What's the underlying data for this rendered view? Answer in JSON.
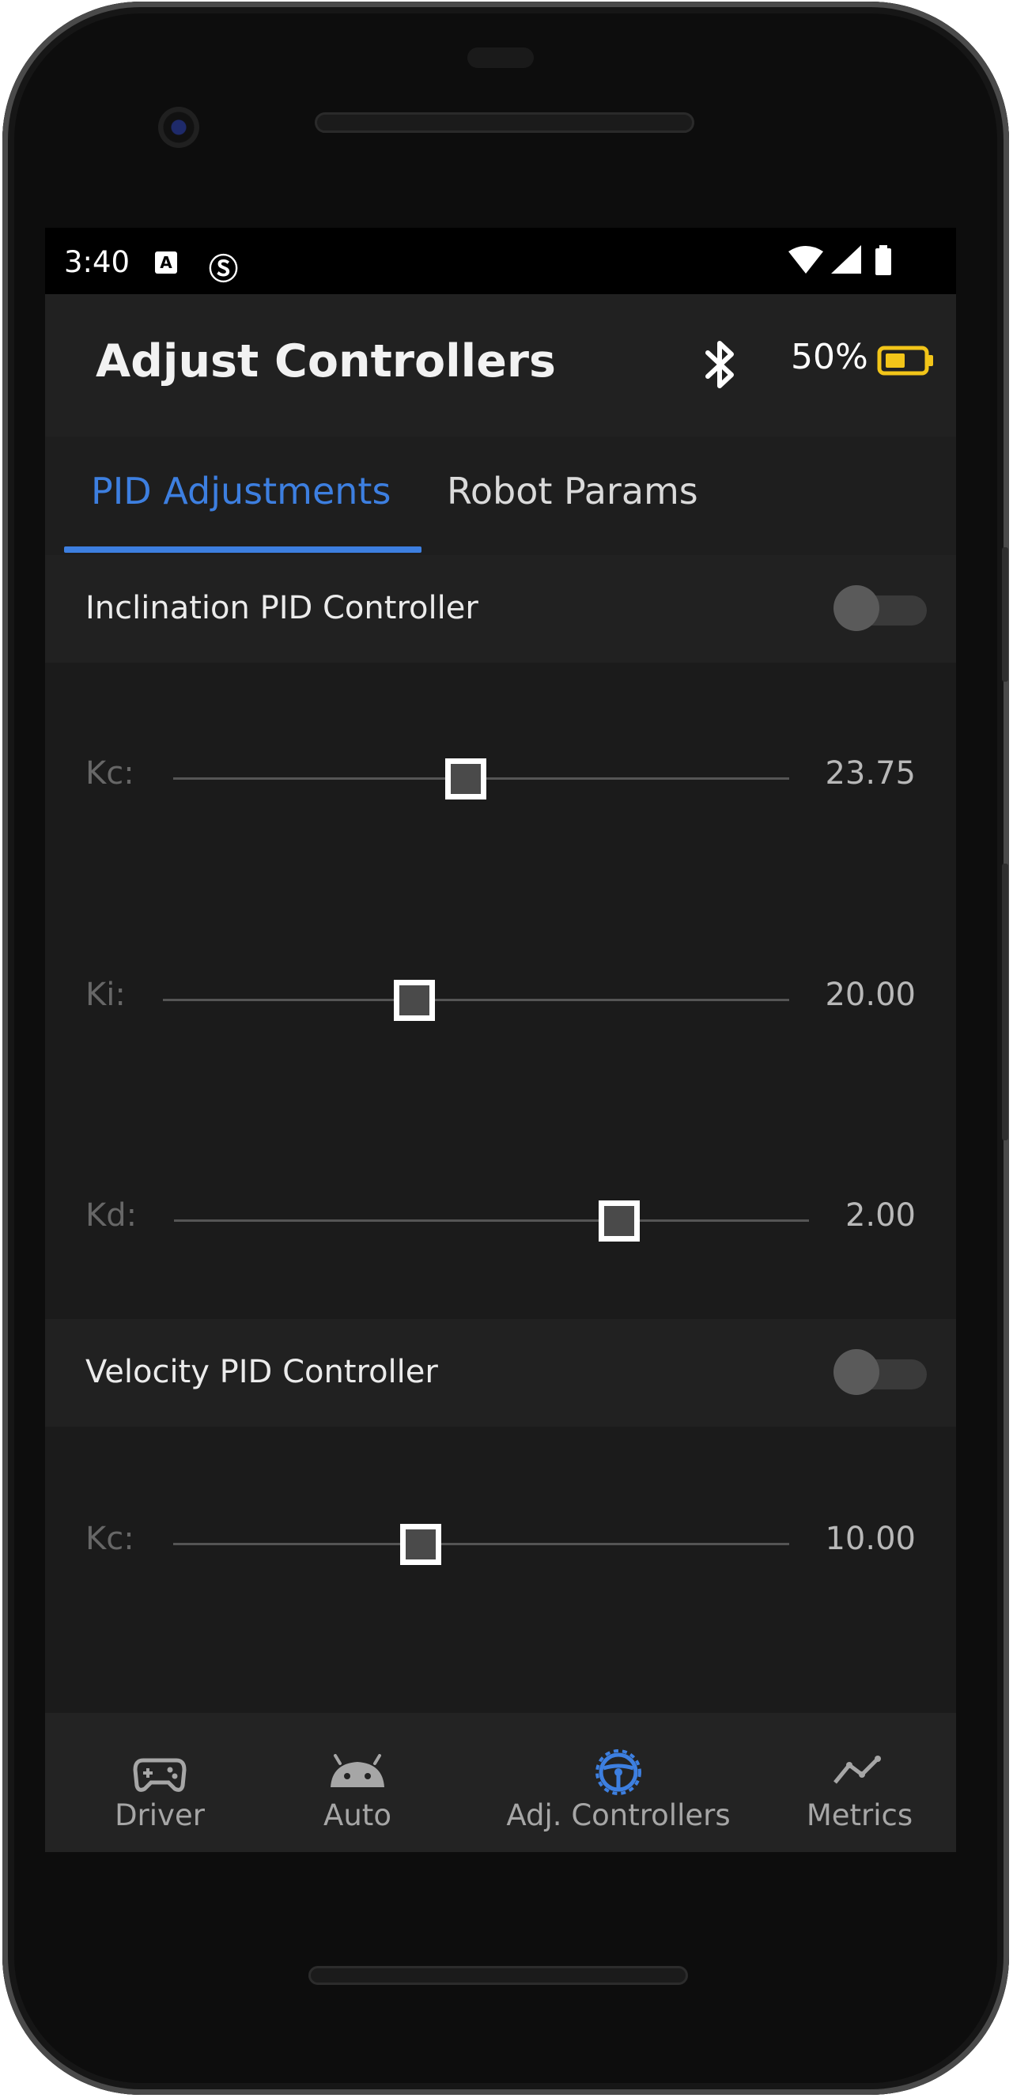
{
  "status_bar": {
    "time": "3:40",
    "notif_a": "A"
  },
  "app_bar": {
    "title": "Adjust Controllers",
    "battery_percent": "50%"
  },
  "tabs": [
    {
      "label": "PID Adjustments",
      "active": true
    },
    {
      "label": "Robot Params",
      "active": false
    }
  ],
  "inclination": {
    "title": "Inclination PID Controller",
    "enabled": false,
    "sliders": [
      {
        "label": "Kc:",
        "value": "23.75"
      },
      {
        "label": "Ki:",
        "value": "20.00"
      },
      {
        "label": "Kd:",
        "value": "2.00"
      }
    ]
  },
  "velocity": {
    "title": "Velocity PID Controller",
    "enabled": false,
    "sliders": [
      {
        "label": "Kc:",
        "value": "10.00"
      }
    ]
  },
  "bottom_nav": [
    {
      "label": "Driver",
      "icon": "gamepad-icon",
      "active": false
    },
    {
      "label": "Auto",
      "icon": "android-icon",
      "active": false
    },
    {
      "label": "Adj. Controllers",
      "icon": "steering-wheel-icon",
      "active": true
    },
    {
      "label": "Metrics",
      "icon": "line-chart-icon",
      "active": false
    }
  ],
  "colors": {
    "accent": "#3d7fe0",
    "battery": "#f2c519",
    "background": "#1b1b1b"
  }
}
